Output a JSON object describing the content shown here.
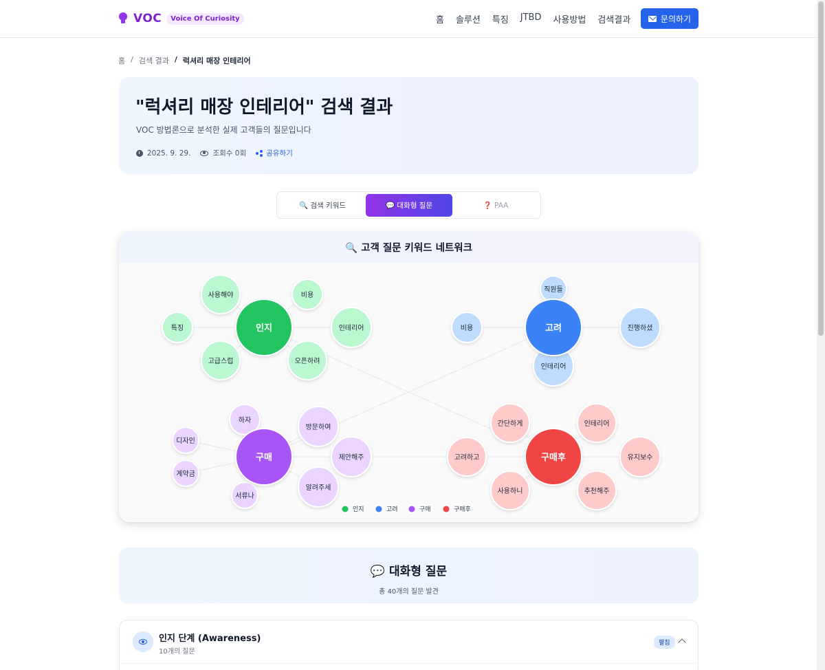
{
  "header": {
    "logo": "VOC",
    "logo_badge": "Voice Of Curiosity",
    "nav": [
      "홈",
      "솔루션",
      "특징",
      "JTBD",
      "사용방법",
      "검색결과"
    ],
    "cta": "문의하기"
  },
  "breadcrumb": {
    "home": "홈",
    "results": "검색 결과",
    "current": "럭셔리 매장 인테리어"
  },
  "hero": {
    "title": "\"럭셔리 매장 인테리어\" 검색 결과",
    "subtitle": "VOC 방법론으로 분석한 실제 고객들의 질문입니다",
    "date": "2025. 9. 29.",
    "views": "조회수 0회",
    "share": "공유하기"
  },
  "tabs": {
    "keywords": "🔍 검색 키워드",
    "conversational": "💬 대화형 질문",
    "paa": "❓ PAA",
    "active": "conversational"
  },
  "network": {
    "title": "🔍 고객 질문 키워드 네트워크",
    "clusters": [
      {
        "name": "인지",
        "color": "#22c55e",
        "light": "#bbf7d0",
        "keywords": [
          "사용해야",
          "비용",
          "특징",
          "인테리어",
          "고급스럽",
          "오픈하려"
        ]
      },
      {
        "name": "고려",
        "color": "#3b82f6",
        "light": "#bfdbfe",
        "keywords": [
          "직원들",
          "비용",
          "진행하셨",
          "인테리어"
        ]
      },
      {
        "name": "구매",
        "color": "#a855f7",
        "light": "#e9d5ff",
        "keywords": [
          "하자",
          "방문하여",
          "디자인",
          "제안해주",
          "계약금",
          "알려주세",
          "서류나"
        ]
      },
      {
        "name": "구매후",
        "color": "#ef4444",
        "light": "#fecaca",
        "keywords": [
          "간단하게",
          "인테리어",
          "고려하고",
          "유지보수",
          "사용하니",
          "추천해주"
        ]
      }
    ],
    "legend": [
      "인지",
      "고려",
      "구매",
      "구매후"
    ]
  },
  "questions": {
    "title": "💬 대화형 질문",
    "summary": "총 40개의 질문 발견"
  },
  "stage": {
    "title": "인지 단계 (Awareness)",
    "count": "10개의 질문",
    "toggle": "펼침"
  }
}
